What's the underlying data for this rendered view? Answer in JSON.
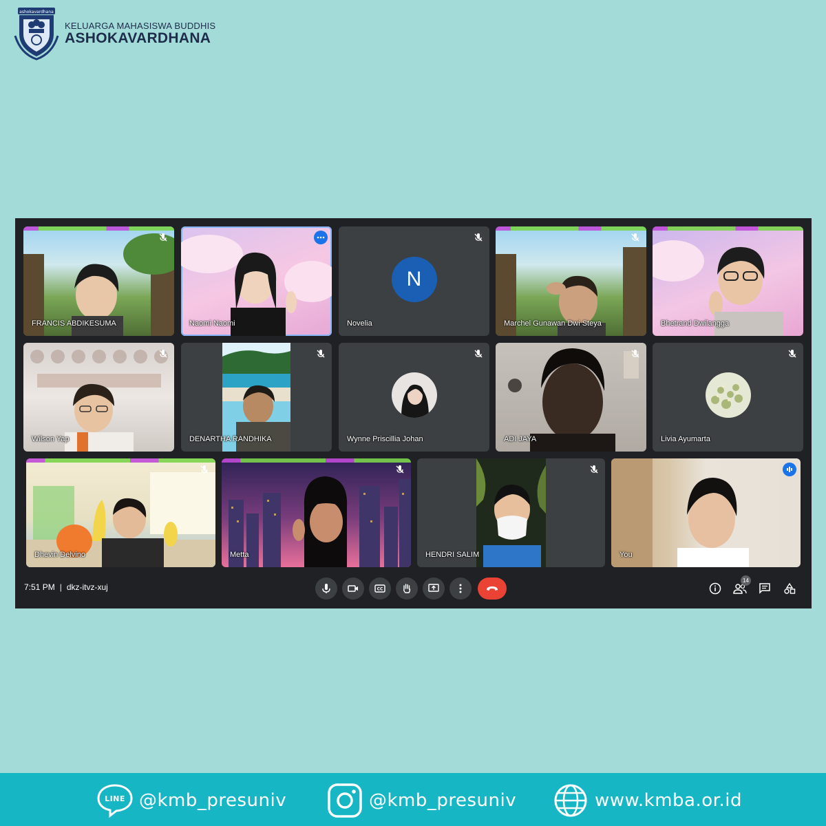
{
  "brand": {
    "line1": "KELUARGA MAHASISWA BUDDHIS",
    "line2": "ASHOKAVARDHANA",
    "emblem_caption": "ashokavardhana",
    "colors": {
      "text": "#1d2c4a",
      "emblem": "#1f3b73"
    }
  },
  "meet": {
    "participants": [
      {
        "name": "FRANCIS ABDIKESUMA",
        "muted": true,
        "kind": "video",
        "bg": "forest"
      },
      {
        "name": "Naomi Naomi",
        "muted": false,
        "kind": "video",
        "bg": "pink-clouds",
        "active": true
      },
      {
        "name": "Novelia",
        "muted": true,
        "kind": "initial",
        "initial": "N"
      },
      {
        "name": "Marchel Gunawan Dwi Steya",
        "muted": true,
        "kind": "video",
        "bg": "forest"
      },
      {
        "name": "Bhetrand Dwilangga",
        "muted": false,
        "kind": "video",
        "bg": "pink-clouds"
      },
      {
        "name": "Wilson Yap",
        "muted": true,
        "kind": "video",
        "bg": "room"
      },
      {
        "name": "DENARTHA RANDHIKA",
        "muted": true,
        "kind": "video",
        "bg": "beach"
      },
      {
        "name": "Wynne Priscillia Johan",
        "muted": true,
        "kind": "avatar"
      },
      {
        "name": "ADI JAYA",
        "muted": true,
        "kind": "video",
        "bg": "dark-room"
      },
      {
        "name": "Livia Ayumarta",
        "muted": true,
        "kind": "avatar"
      },
      {
        "name": "Dhevin Delvino",
        "muted": true,
        "kind": "video",
        "bg": "cartoon-classroom"
      },
      {
        "name": "Metta",
        "muted": true,
        "kind": "video",
        "bg": "city-night"
      },
      {
        "name": "HENDRI SALIM",
        "muted": true,
        "kind": "video",
        "bg": "night"
      },
      {
        "name": "You",
        "muted": false,
        "kind": "video",
        "bg": "bedroom",
        "speaking": true
      }
    ],
    "bottom_bar": {
      "time": "7:51 PM",
      "separator": "|",
      "meeting_code": "dkz-itvz-xuj",
      "controls": [
        "mic-icon",
        "camera-icon",
        "captions-icon",
        "raise-hand-icon",
        "present-icon",
        "more-options-icon",
        "end-call-icon"
      ],
      "right_icons": [
        "info-icon",
        "people-icon",
        "chat-icon",
        "activities-icon"
      ],
      "people_count": "14"
    },
    "colors": {
      "end_call": "#ea4335",
      "active_outline": "#8ab4f8",
      "accent": "#1a73e8"
    }
  },
  "footer": {
    "line_handle": "@kmb_presuniv",
    "instagram_handle": "@kmb_presuniv",
    "website": "www.kmba.or.id",
    "line_logo_text": "LINE",
    "icons": [
      "line-icon",
      "instagram-icon",
      "globe-icon"
    ],
    "color": "#17b6c5"
  }
}
